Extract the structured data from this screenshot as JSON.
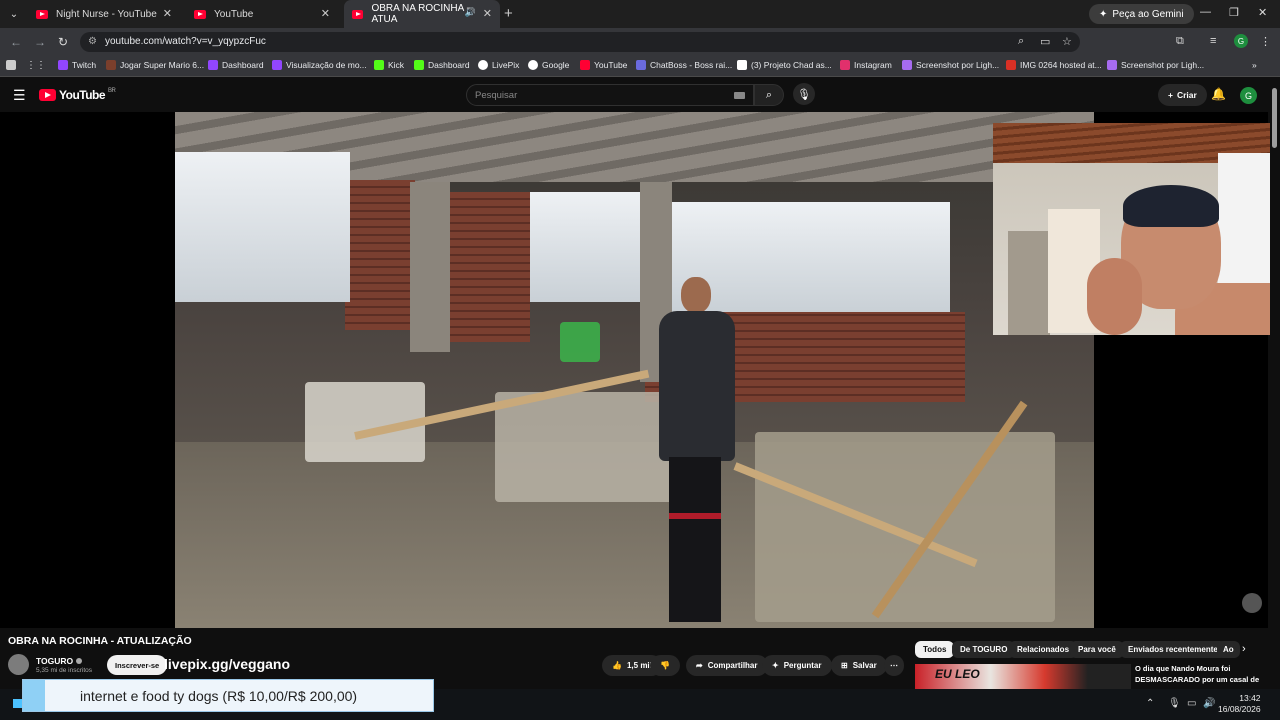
{
  "browser": {
    "tabs": [
      {
        "title": "Night Nurse - YouTube"
      },
      {
        "title": "YouTube"
      },
      {
        "title": "OBRA NA ROCINHA - ATUA"
      }
    ],
    "gemini_label": "Peça ao Gemini",
    "url": "youtube.com/watch?v=v_yqypzcFuc",
    "profile_initial": "G",
    "bookmarks": [
      {
        "label": "Twitch",
        "color": "#9146ff"
      },
      {
        "label": "Jogar Super Mario 6...",
        "color": "#7b3f2c"
      },
      {
        "label": "Dashboard",
        "color": "#9146ff"
      },
      {
        "label": "Visualização de mo...",
        "color": "#9146ff"
      },
      {
        "label": "Kick",
        "color": "#53fc18"
      },
      {
        "label": "Dashboard",
        "color": "#53fc18"
      },
      {
        "label": "LivePix",
        "color": "#ffffff"
      },
      {
        "label": "Google",
        "color": "#ffffff"
      },
      {
        "label": "YouTube",
        "color": "#ff0033"
      },
      {
        "label": "ChatBoss - Boss rai...",
        "color": "#6a6ade"
      },
      {
        "label": "(3) Projeto Chad as...",
        "color": "#ffffff"
      },
      {
        "label": "Instagram",
        "color": "#e1306c"
      },
      {
        "label": "Screenshot por Ligh...",
        "color": "#a66bf0"
      },
      {
        "label": "IMG 0264 hosted at...",
        "color": "#d93025"
      },
      {
        "label": "Screenshot por Ligh...",
        "color": "#a66bf0"
      }
    ]
  },
  "youtube": {
    "logo": "YouTube",
    "logo_country": "BR",
    "search_placeholder": "Pesquisar",
    "create_label": "Criar",
    "account_initial": "G"
  },
  "video": {
    "title": "OBRA NA ROCINHA - ATUALIZAÇÃO",
    "channel": "TOGURO",
    "subscribers": "5,35 mi de inscritos",
    "subscribe_label": "Inscrever-se",
    "overlay_text": "livepix.gg/veggano",
    "likes": "1,5 mil",
    "share_label": "Compartilhar",
    "ask_label": "Perguntar",
    "save_label": "Salvar"
  },
  "sidebar": {
    "chips": [
      "Todos",
      "De TOGURO",
      "Relacionados",
      "Para você",
      "Enviados recentemente",
      "Ao"
    ],
    "rec_thumb_caption": "EU LEO",
    "rec_title": "O dia que Nando Moura foi DESMASCARADO por um casal de"
  },
  "alert": {
    "text": "internet e food ty dogs (R$ 10,00/R$ 200,00)"
  },
  "taskbar": {
    "time": "13:42",
    "date": "16/08/2026"
  },
  "colors": {
    "accent_red": "#ff0033",
    "background": "#0f0f0f"
  }
}
